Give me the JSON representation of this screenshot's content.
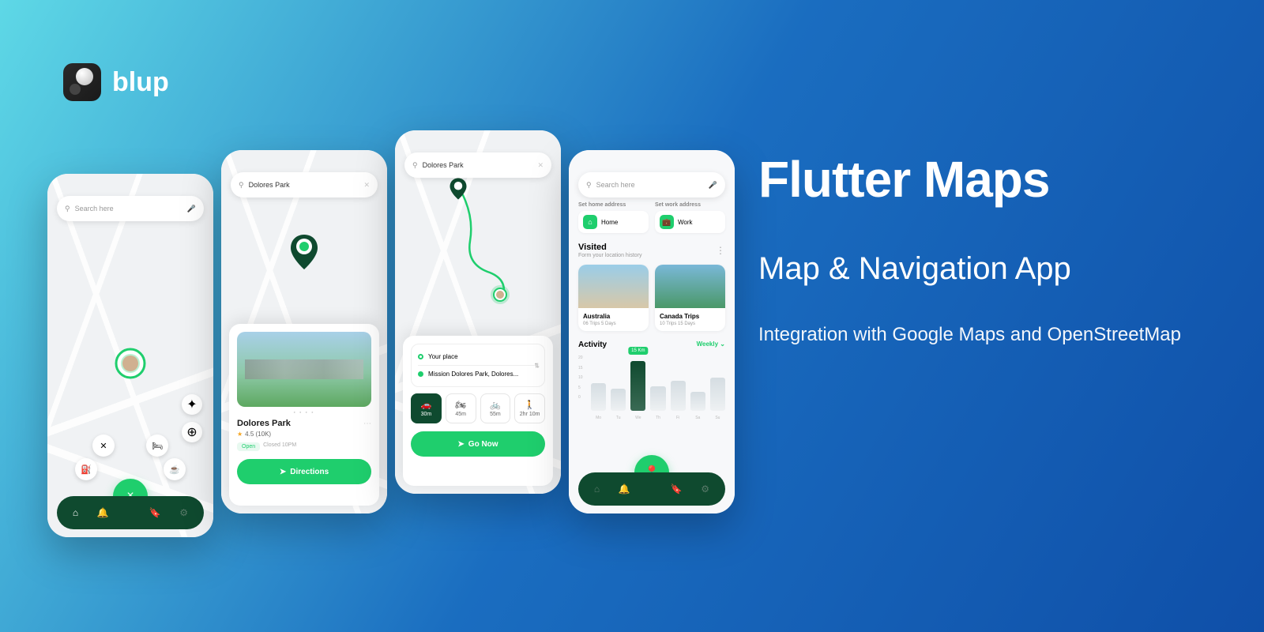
{
  "brand": "blup",
  "hero": {
    "title": "Flutter Maps",
    "subtitle": "Map & Navigation App",
    "description": "Integration with Google Maps and OpenStreetMap"
  },
  "colors": {
    "accent": "#1FCE6D",
    "dark": "#0F4A2F"
  },
  "screen1": {
    "search_placeholder": "Search here",
    "radial_close": "×"
  },
  "screen2": {
    "search_value": "Dolores Park",
    "place_title": "Dolores Park",
    "rating_text": "4.5 (10K)",
    "open_label": "Open",
    "closed_label": "Closed 10PM",
    "directions_btn": "Directions"
  },
  "screen3": {
    "search_value": "Dolores Park",
    "origin": "Your place",
    "destination": "Mission Dolores Park, Dolores...",
    "modes": [
      {
        "icon": "car",
        "time": "30m",
        "active": true
      },
      {
        "icon": "motorcycle",
        "time": "45m",
        "active": false
      },
      {
        "icon": "bicycle",
        "time": "55m",
        "active": false
      },
      {
        "icon": "walk",
        "time": "2hr 10m",
        "active": false
      }
    ],
    "go_btn": "Go Now"
  },
  "screen4": {
    "search_placeholder": "Search here",
    "home_label": "Set home address",
    "home_value": "Home",
    "work_label": "Set work address",
    "work_value": "Work",
    "visited_title": "Visited",
    "visited_sub": "Form your location history",
    "visited_cards": [
      {
        "name": "Australia",
        "meta": "06 Trips   5 Days"
      },
      {
        "name": "Canada Trips",
        "meta": "10 Trips   15 Days"
      }
    ],
    "activity_title": "Activity",
    "activity_filter": "Weekly",
    "chart_tooltip": "15 Km"
  },
  "chart_data": {
    "type": "bar",
    "categories": [
      "Mo",
      "Tu",
      "We",
      "Th",
      "Fi",
      "Sa",
      "Su"
    ],
    "values": [
      10,
      8,
      18,
      9,
      11,
      7,
      12
    ],
    "ylim": [
      0,
      20
    ],
    "yticks": [
      20,
      15,
      10,
      5,
      0
    ],
    "highlight_index": 2,
    "highlight_label": "15 Km"
  }
}
